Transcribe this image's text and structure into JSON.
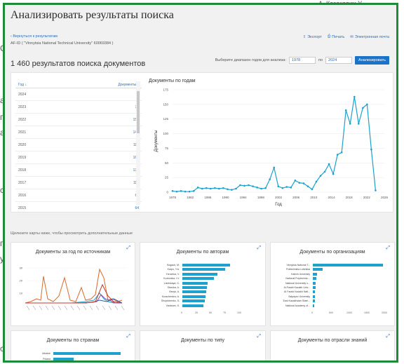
{
  "background": {
    "letters": [
      "С",
      "а",
      "г",
      "а",
      "с",
      "г",
      "у",
      "с"
    ],
    "top_right_text": "А. Казакевич У"
  },
  "title": "Анализировать результаты поиска",
  "back_link": "‹ Вернуться к результатам",
  "query": "AF-ID ( \"Vinnytsia National Technical University\"   60069384 )",
  "actions": {
    "export": "Экспорт",
    "print": "Печать",
    "email": "Электронная почта"
  },
  "results_heading": "1 460 результатов поиска документов",
  "year_range": {
    "label": "Выберите диапазон годов для анализа:",
    "from": "1978",
    "to_label": "по",
    "to": "2024",
    "button": "Анализировать"
  },
  "table": {
    "col_year": "Год ↓",
    "col_docs": "Документы ↑",
    "rows": [
      {
        "year": "2024",
        "docs": "3"
      },
      {
        "year": "2023",
        "docs": "73"
      },
      {
        "year": "2022",
        "docs": "150"
      },
      {
        "year": "2021",
        "docs": "144"
      },
      {
        "year": "2020",
        "docs": "117"
      },
      {
        "year": "2019",
        "docs": "163"
      },
      {
        "year": "2018",
        "docs": "131"
      },
      {
        "year": "2017",
        "docs": "117"
      },
      {
        "year": "2016",
        "docs": "68"
      },
      {
        "year": "2015",
        "docs": "64"
      }
    ]
  },
  "chart_data": {
    "type": "line",
    "title": "Документы по годам",
    "xlabel": "Год",
    "ylabel": "Документы",
    "x": [
      1978,
      1979,
      1980,
      1981,
      1982,
      1983,
      1984,
      1985,
      1986,
      1987,
      1988,
      1989,
      1990,
      1991,
      1992,
      1993,
      1994,
      1995,
      1996,
      1997,
      1998,
      1999,
      2000,
      2001,
      2002,
      2003,
      2004,
      2005,
      2006,
      2007,
      2008,
      2009,
      2010,
      2011,
      2012,
      2013,
      2014,
      2015,
      2016,
      2017,
      2018,
      2019,
      2020,
      2021,
      2022,
      2023,
      2024
    ],
    "values": [
      2,
      1,
      2,
      1,
      1,
      2,
      8,
      6,
      7,
      6,
      7,
      6,
      7,
      5,
      4,
      6,
      12,
      11,
      12,
      10,
      8,
      6,
      7,
      22,
      42,
      10,
      7,
      9,
      8,
      20,
      16,
      15,
      10,
      5,
      18,
      28,
      35,
      48,
      31,
      64,
      68,
      140,
      117,
      163,
      117,
      144,
      150,
      73,
      3
    ],
    "xticks": [
      1978,
      1982,
      1986,
      1990,
      1994,
      1998,
      2002,
      2006,
      2010,
      2014,
      2018,
      2022,
      2026
    ],
    "yticks": [
      0,
      25,
      50,
      75,
      100,
      125,
      150,
      175
    ],
    "ylim": [
      0,
      175
    ],
    "xlim": [
      1978,
      2026
    ],
    "color": "#1ea1cc"
  },
  "hint": "Щелкните карты ниже, чтобы просмотреть дополнительные данные",
  "cards": {
    "sources": {
      "title": "Документы за год по источникам",
      "yticks": [
        "30",
        "20",
        "10"
      ]
    },
    "authors": {
      "title": "Документы по авторам",
      "bars": [
        {
          "label": "Bogach, M.",
          "value": 0.85
        },
        {
          "label": "Karpo, Y.A.",
          "value": 0.76
        },
        {
          "label": "Yurochka, V.",
          "value": 0.63
        },
        {
          "label": "Kozlovska, I.V.",
          "value": 0.56
        },
        {
          "label": "Lisniskaya, G.",
          "value": 0.45
        },
        {
          "label": "Staruba, A.",
          "value": 0.44
        },
        {
          "label": "Bevyk, A.",
          "value": 0.42
        },
        {
          "label": "Kurachenkov, A.",
          "value": 0.41
        },
        {
          "label": "Shvydchenko, S.",
          "value": 0.4
        },
        {
          "label": "Volobuev, S.",
          "value": 0.38
        }
      ],
      "xticks": [
        "0",
        "25",
        "50",
        "75",
        "100"
      ]
    },
    "organizations": {
      "title": "Документы по организациям",
      "bars": [
        {
          "label": "Vinnytsia National T...",
          "value": 1.0
        },
        {
          "label": "Politechnika Lubelska",
          "value": 0.14
        },
        {
          "label": "Kalinin University",
          "value": 0.06
        },
        {
          "label": "National Polytechnic...",
          "value": 0.05
        },
        {
          "label": "National University o...",
          "value": 0.04
        },
        {
          "label": "Al-Farabi Kazakh Univ...",
          "value": 0.04
        },
        {
          "label": "AI Farabi Kazakh Nati...",
          "value": 0.03
        },
        {
          "label": "Satpayev University",
          "value": 0.03
        },
        {
          "label": "East Kazakhstan State...",
          "value": 0.03
        },
        {
          "label": "National Academy of...",
          "value": 0.02
        }
      ],
      "xticks": [
        "0",
        "500",
        "1000",
        "1500",
        "2000"
      ]
    },
    "countries": {
      "title": "Документы по странам",
      "bars": [
        {
          "label": "Ukraine",
          "value": 1.0
        },
        {
          "label": "Poland",
          "value": 0.3
        }
      ]
    },
    "types": {
      "title": "Документы по типу"
    },
    "subjects": {
      "title": "Документы по отрасли знаний"
    }
  }
}
